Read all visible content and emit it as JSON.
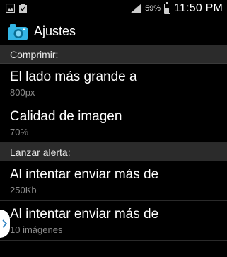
{
  "status_bar": {
    "battery_percent": "59%",
    "time": "11:50 PM",
    "icons": [
      "gallery-icon",
      "clipboard-check-icon",
      "signal-icon",
      "battery-icon"
    ]
  },
  "action_bar": {
    "title": "Ajustes",
    "icon": "camera-icon"
  },
  "sections": [
    {
      "header": "Comprimir:",
      "items": [
        {
          "title": "El lado más grande a",
          "summary": "800px"
        },
        {
          "title": "Calidad de imagen",
          "summary": "70%"
        }
      ]
    },
    {
      "header": "Lanzar alerta:",
      "items": [
        {
          "title": "Al intentar enviar más de",
          "summary": "250Kb"
        },
        {
          "title": "Al intentar enviar más de",
          "summary": "10 imágenes"
        }
      ]
    }
  ],
  "colors": {
    "background": "#000000",
    "category_bg": "#2b2b2b",
    "summary_text": "#8a8a8a",
    "app_icon": "#33b5e5"
  }
}
